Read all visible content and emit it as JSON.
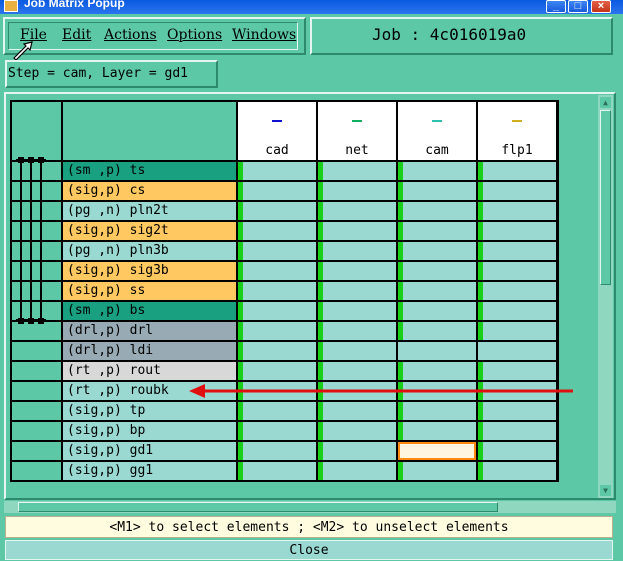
{
  "window": {
    "title": "Job Matrix Popup"
  },
  "menu": [
    "File",
    "Edit",
    "Actions",
    "Options",
    "Windows"
  ],
  "job": {
    "text": "Job : 4c016019a0"
  },
  "step": {
    "text": "Step = cam, Layer = gd1"
  },
  "columns": [
    {
      "label": "cad",
      "color": "#1010d0"
    },
    {
      "label": "net",
      "color": "#10b060"
    },
    {
      "label": "cam",
      "color": "#30c0b0"
    },
    {
      "label": "flp1",
      "color": "#d0b020"
    }
  ],
  "rows": [
    {
      "label": "(sm ,p) ts",
      "color": "#18a080",
      "marks": [
        true,
        true,
        true,
        true
      ]
    },
    {
      "label": "(sig,p) cs",
      "color": "#ffc860",
      "marks": [
        true,
        true,
        true,
        true
      ]
    },
    {
      "label": "(pg ,n) pln2t",
      "color": "#9ad9d2",
      "marks": [
        true,
        true,
        true,
        true
      ]
    },
    {
      "label": "(sig,p) sig2t",
      "color": "#ffc860",
      "marks": [
        true,
        true,
        true,
        true
      ]
    },
    {
      "label": "(pg ,n) pln3b",
      "color": "#9ad9d2",
      "marks": [
        true,
        true,
        true,
        true
      ]
    },
    {
      "label": "(sig,p) sig3b",
      "color": "#ffc860",
      "marks": [
        true,
        true,
        true,
        true
      ]
    },
    {
      "label": "(sig,p) ss",
      "color": "#ffc860",
      "marks": [
        true,
        true,
        true,
        true
      ]
    },
    {
      "label": "(sm ,p) bs",
      "color": "#18a080",
      "marks": [
        true,
        true,
        true,
        true
      ]
    },
    {
      "label": "(drl,p) drl",
      "color": "#98aab4",
      "marks": [
        true,
        true,
        true,
        true
      ]
    },
    {
      "label": "(drl,p) ldi",
      "color": "#98aab4",
      "marks": [
        true,
        true,
        false,
        false
      ]
    },
    {
      "label": "(rt ,p) rout",
      "color": "#d8d8d8",
      "marks": [
        true,
        true,
        true,
        true
      ]
    },
    {
      "label": "(rt ,p) roubk",
      "color": "#9ad9d2",
      "marks": [
        true,
        true,
        true,
        true
      ]
    },
    {
      "label": "(sig,p) tp",
      "color": "#9ad9d2",
      "marks": [
        true,
        true,
        true,
        true
      ]
    },
    {
      "label": "(sig,p) bp",
      "color": "#9ad9d2",
      "marks": [
        true,
        true,
        true,
        true
      ]
    },
    {
      "label": "(sig,p) gd1",
      "color": "#9ad9d2",
      "marks": [
        true,
        true,
        false,
        true
      ],
      "selected_col": 2
    },
    {
      "label": "(sig,p) gg1",
      "color": "#9ad9d2",
      "marks": [
        true,
        true,
        true,
        true
      ]
    }
  ],
  "status": {
    "text": "<M1> to select elements ; <M2> to unselect elements"
  },
  "close_label": "Close",
  "annotation_arrow_color": "#e01010"
}
